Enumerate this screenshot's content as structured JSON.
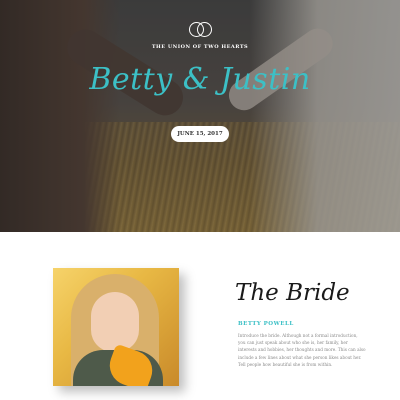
{
  "hero": {
    "tagline": "THE UNION OF TWO HEARTS",
    "names": "Betty & Justin",
    "date": "JUNE 15, 2017"
  },
  "bride": {
    "title": "The Bride",
    "name": "BETTY POWELL",
    "intro": "Introduce the bride. Although not a formal introduction, you can just speak about who she is, her family, her interests and hobbies, her thoughts and more. This can also include a few lines about what she person likes about her. Tell people how beautiful she is from within."
  },
  "colors": {
    "accent": "#3cc0c6",
    "overlay": "#3a3a3a"
  },
  "icons": {
    "rings": "wedding-rings-icon"
  }
}
